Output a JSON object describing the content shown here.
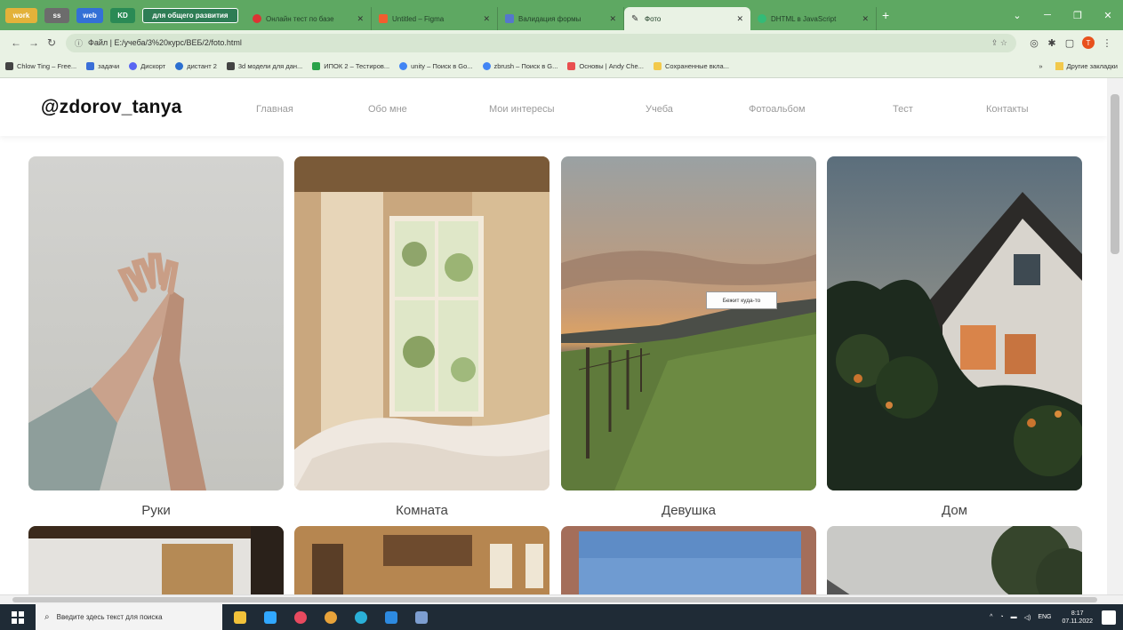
{
  "browser": {
    "tab_groups": [
      {
        "label": "work",
        "color": "#e3b23a"
      },
      {
        "label": "ss",
        "color": "#6c6c6c"
      },
      {
        "label": "web",
        "color": "#3470d6"
      },
      {
        "label": "KD",
        "color": "#2a8a55"
      },
      {
        "label": "для общего развития",
        "color": "#2e7d55"
      }
    ],
    "tabs": [
      {
        "title": "Онлайн тест по базе",
        "icon_color": "#d33"
      },
      {
        "title": "Untitled – Figma",
        "icon_color": "#f25d2e"
      },
      {
        "title": "Валидация формы",
        "icon_color": "#5577cc"
      },
      {
        "title": "Фото",
        "icon_color": "#333"
      },
      {
        "title": "DHTML в JavaScript",
        "icon_color": "#3b7"
      }
    ],
    "active_tab": "Фото",
    "address": "Файл | E:/учеба/3%20курс/ВЕБ/2/foto.html",
    "bookmarks": [
      {
        "label": "Chlow Ting – Free...",
        "color": "#444"
      },
      {
        "label": "задачи",
        "color": "#3a6fd8"
      },
      {
        "label": "Дискорт",
        "color": "#5865f2"
      },
      {
        "label": "дистант 2",
        "color": "#2b6fd0"
      },
      {
        "label": "3d модели для дан...",
        "color": "#444"
      },
      {
        "label": "ИПОК 2 – Тестиров...",
        "color": "#2aa34a"
      },
      {
        "label": "unity – Поиск в Go...",
        "color": "#4285f4"
      },
      {
        "label": "zbrush – Поиск в G...",
        "color": "#4285f4"
      },
      {
        "label": "Основы | Andy Che...",
        "color": "#e94f4f"
      },
      {
        "label": "Сохраненные вкла...",
        "color": "#f2c94c"
      }
    ],
    "other_bookmarks": "Другие закладки",
    "profile_initial": "T"
  },
  "site": {
    "logo": "@zdorov_tanya",
    "nav": [
      "Главная",
      "Обо мне",
      "Мои интересы",
      "Учеба",
      "Фотоальбом",
      "Тест",
      "Контакты"
    ],
    "photos": [
      {
        "caption": "Руки"
      },
      {
        "caption": "Комната"
      },
      {
        "caption": "Девушка"
      },
      {
        "caption": "Дом"
      }
    ],
    "tooltip": "Бежит куда-то"
  },
  "taskbar": {
    "search_placeholder": "Введите здесь текст для поиска",
    "lang": "ENG",
    "time": "8:17",
    "date": "07.11.2022",
    "apps": [
      {
        "name": "explorer",
        "color": "#f2c23a"
      },
      {
        "name": "photoshop",
        "color": "#31a8ff"
      },
      {
        "name": "discord",
        "color": "#e84a5f"
      },
      {
        "name": "chrome",
        "color": "#e8a33a"
      },
      {
        "name": "edge",
        "color": "#2ab0d8"
      },
      {
        "name": "vscode",
        "color": "#2d8ae0"
      },
      {
        "name": "notes",
        "color": "#7d9ed0"
      }
    ]
  }
}
